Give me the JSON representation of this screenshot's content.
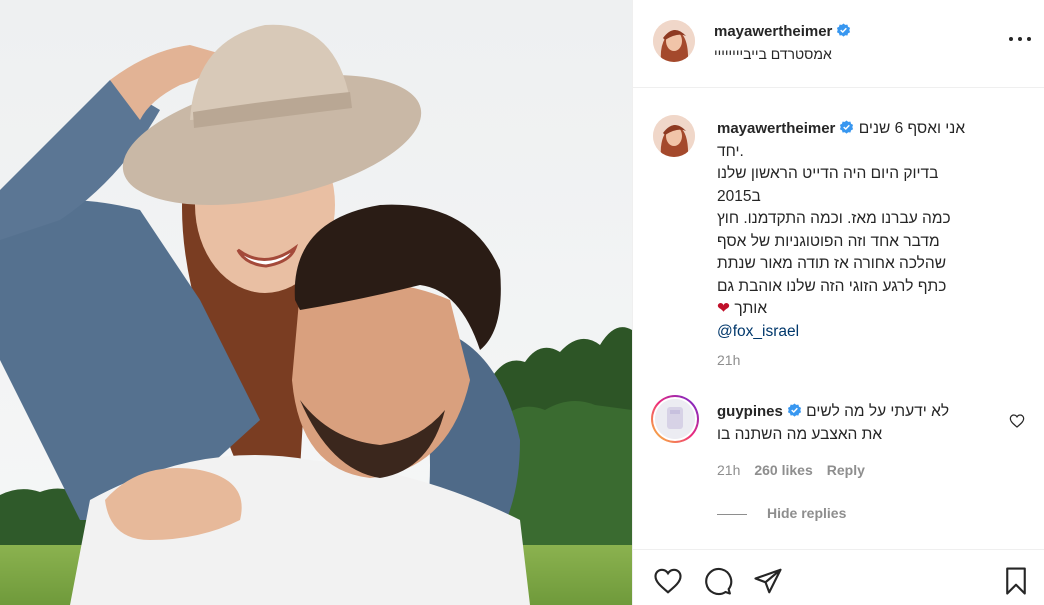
{
  "post": {
    "username": "mayawertheimer",
    "location": "אמסטרדם בייביייייייי"
  },
  "caption": {
    "username": "mayawertheimer",
    "lines": [
      "אני ואסף 6 שנים",
      "יחד.",
      "בדיוק היום היה הדייט הראשון שלנו",
      "ב2015",
      "כמה עברנו מאז. וכמה התקדמנו. חוץ",
      "מדבר אחד וזה הפוטוגניות של אסף",
      "שהלכה אחורה אז תודה מאור שנתת",
      "כתף לרגע הזוגי הזה שלנו אוהבת גם",
      "אותך"
    ],
    "heart": "❤",
    "mention": "@fox_israel",
    "time": "21h"
  },
  "comment": {
    "username": "guypines",
    "lines": [
      "לא ידעתי על מה לשים",
      "את האצבע מה השתנה בו"
    ],
    "time": "21h",
    "likes": "260 likes",
    "reply_label": "Reply",
    "hide_replies_label": "Hide replies"
  },
  "icons": {
    "verified": "verified-badge-icon",
    "more": "more-options-icon",
    "like": "heart-icon",
    "comment": "comment-icon",
    "share": "paper-plane-icon",
    "save": "bookmark-icon"
  },
  "colors": {
    "verified_blue": "#3897f0",
    "heart_red": "#c0102a",
    "mention": "#00376b",
    "muted": "#8e8e8e"
  }
}
